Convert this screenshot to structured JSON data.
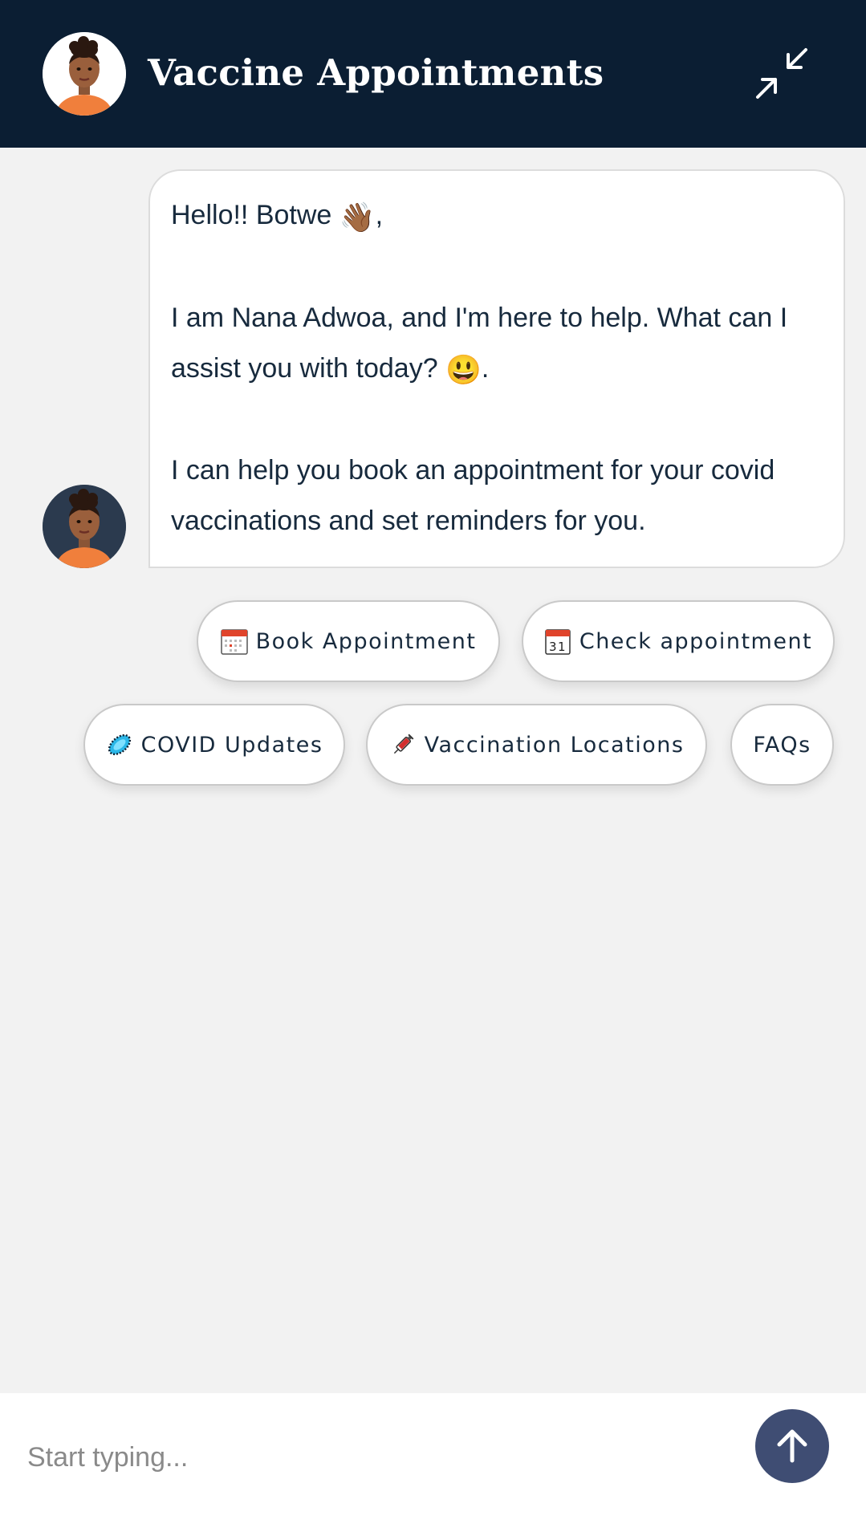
{
  "header": {
    "title": "Vaccine Appointments",
    "avatar_icon": "woman-avatar-icon",
    "minimize_icon": "minimize-arrows-icon",
    "background": "#0b1e33"
  },
  "message": {
    "greeting": "Hello!! Botwe",
    "greeting_suffix": ",",
    "greeting_emoji": "👋🏾",
    "intro_line": "I am Nana Adwoa, and I'm here to help. What can I assist you with today?",
    "intro_emoji": "😃",
    "intro_suffix": ".",
    "help_line": "I can help you book an appointment for your covid vaccinations and set reminders for you."
  },
  "quick_replies": [
    {
      "label": "Book Appointment",
      "icon": "calendar-icon"
    },
    {
      "label": "Check appointment",
      "icon": "date-calendar-icon"
    },
    {
      "label": "COVID Updates",
      "icon": "microbe-icon"
    },
    {
      "label": "Vaccination Locations",
      "icon": "syringe-icon"
    },
    {
      "label": "FAQs",
      "icon": ""
    }
  ],
  "composer": {
    "placeholder": "Start typing...",
    "value": "",
    "send_icon": "arrow-up-icon",
    "send_color": "#3f4d73"
  }
}
